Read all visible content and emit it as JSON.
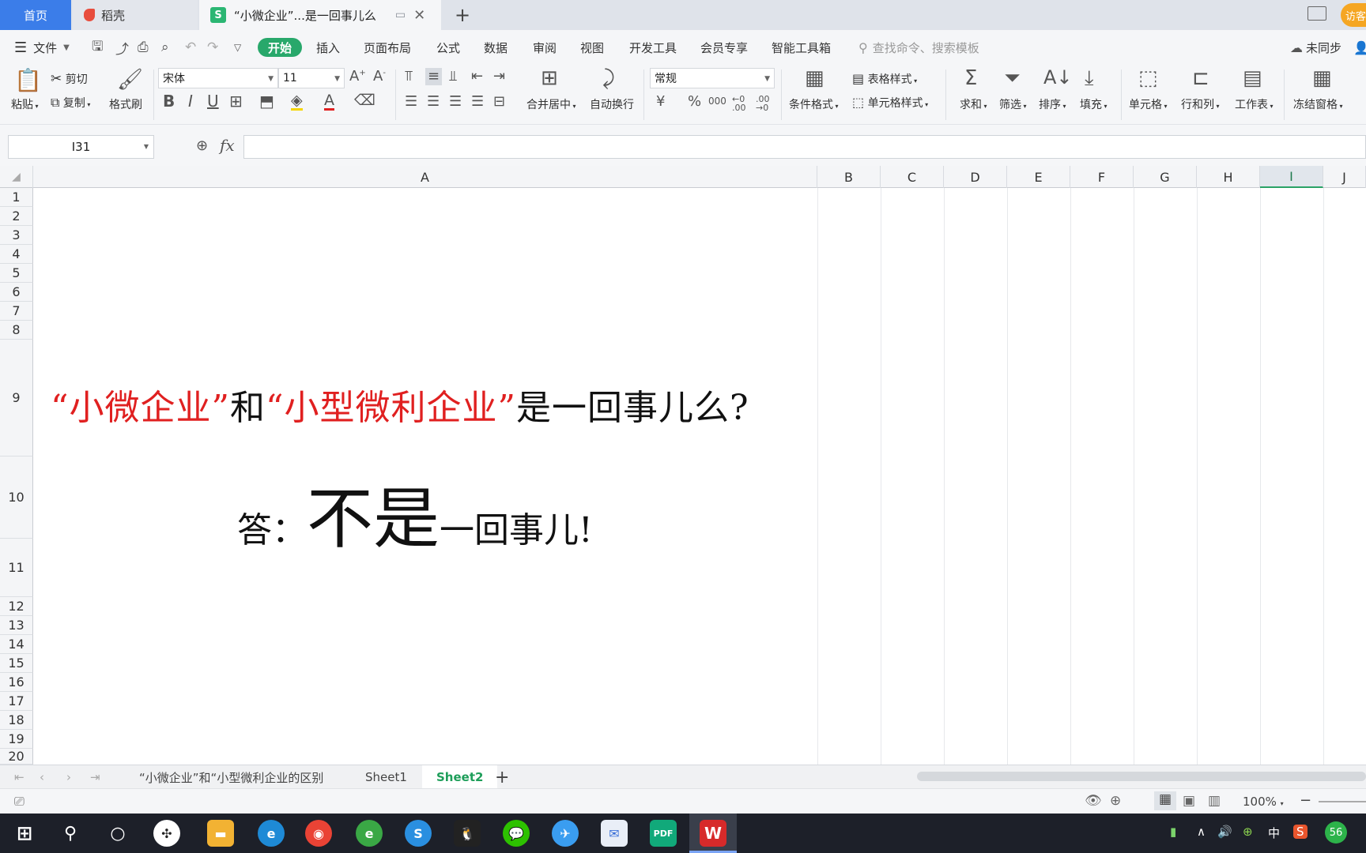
{
  "tabs": {
    "home": "首页",
    "daoke": "稻壳",
    "doc": "“小微企业”...是一回事儿么",
    "visitor": "访客"
  },
  "menu": {
    "file": "文件",
    "items": [
      "开始",
      "插入",
      "页面布局",
      "公式",
      "数据",
      "审阅",
      "视图",
      "开发工具",
      "会员专享",
      "智能工具箱"
    ],
    "search_placeholder": "查找命令、搜索模板",
    "sync": "未同步"
  },
  "ribbon": {
    "paste": "粘贴",
    "cut": "剪切",
    "copy": "复制",
    "format_painter": "格式刷",
    "font_name": "宋体",
    "font_size": "11",
    "merge_center": "合并居中",
    "wrap_text": "自动换行",
    "number_format": "常规",
    "conditional_format": "条件格式",
    "table_style": "表格样式",
    "cell_style": "单元格样式",
    "sum": "求和",
    "filter": "筛选",
    "sort": "排序",
    "fill": "填充",
    "cells": "单元格",
    "row_col": "行和列",
    "worksheet": "工作表",
    "freeze": "冻结窗格"
  },
  "formula_bar": {
    "name_box": "I31",
    "fx": "fx",
    "value": ""
  },
  "grid": {
    "columns": [
      "A",
      "B",
      "C",
      "D",
      "E",
      "F",
      "G",
      "H",
      "I",
      "J"
    ],
    "selected_column": "I",
    "rows": [
      "1",
      "2",
      "3",
      "4",
      "5",
      "6",
      "7",
      "8",
      "9",
      "10",
      "11",
      "12",
      "13",
      "14",
      "15",
      "16",
      "17",
      "18",
      "19",
      "20"
    ],
    "question": {
      "q1": "“小微企业”",
      "and": "和",
      "q2": "“小型微利企业”",
      "rest": "是一回事儿么?"
    },
    "answer": {
      "prefix": "答：",
      "big": "不是",
      "rest": "一回事儿!"
    }
  },
  "sheets": [
    "“小微企业”和“小型微利企业的区别",
    "Sheet1",
    "Sheet2"
  ],
  "active_sheet": "Sheet2",
  "status": {
    "zoom": "100%"
  },
  "taskbar": {
    "ime": "中",
    "badge": "56"
  },
  "colors": {
    "accent": "#28a86b",
    "home_tab": "#3b7de9",
    "red_text": "#e02020"
  }
}
